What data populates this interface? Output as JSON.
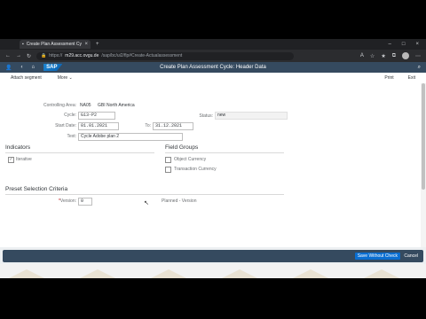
{
  "browser": {
    "tab_title": "Create Plan Assessment Cycle: H",
    "tab_close": "×",
    "new_tab": "+",
    "window_controls": [
      "–",
      "□",
      "×"
    ],
    "nav_icons": [
      "back-icon",
      "forward-icon",
      "reload-icon"
    ],
    "url_prefix": "https://",
    "url_host": "m29.acc.ovgu.de",
    "url_path": "/sap/bc/ui2/flp#Create-Actualassessment"
  },
  "shell": {
    "title": "Create Plan Assessment Cycle: Header Data",
    "logo": "SAP"
  },
  "toolbar": {
    "attach_segment": "Attach segment",
    "more": "More ⌄",
    "print": "Print",
    "exit": "Exit"
  },
  "form": {
    "controlling_area_label": "Controlling Area:",
    "controlling_area_value": "NA05",
    "controlling_area_desc": "GBI North America",
    "cycle_label": "Cycle:",
    "cycle_value": "G13-P2",
    "status_label": "Status:",
    "status_value": "new",
    "start_date_label": "Start Date:",
    "start_date_value": "01.01.2021",
    "to_label": "To:",
    "to_value": "31.12.2021",
    "text_label": "Text:",
    "text_value": "Cycle Adobe plan 2"
  },
  "indicators": {
    "title": "Indicators",
    "iterative_label": "Iterative",
    "iterative_checked": true
  },
  "field_groups": {
    "title": "Field Groups",
    "object_currency": "Object Currency",
    "transaction_currency": "Transaction Currency"
  },
  "preset": {
    "title": "Preset Selection Criteria",
    "version_label": "Version:",
    "version_required": "*",
    "version_value": "0",
    "version_desc": "Planned - Version"
  },
  "footer": {
    "save_without_check": "Save Without Check",
    "cancel": "Cancel"
  }
}
